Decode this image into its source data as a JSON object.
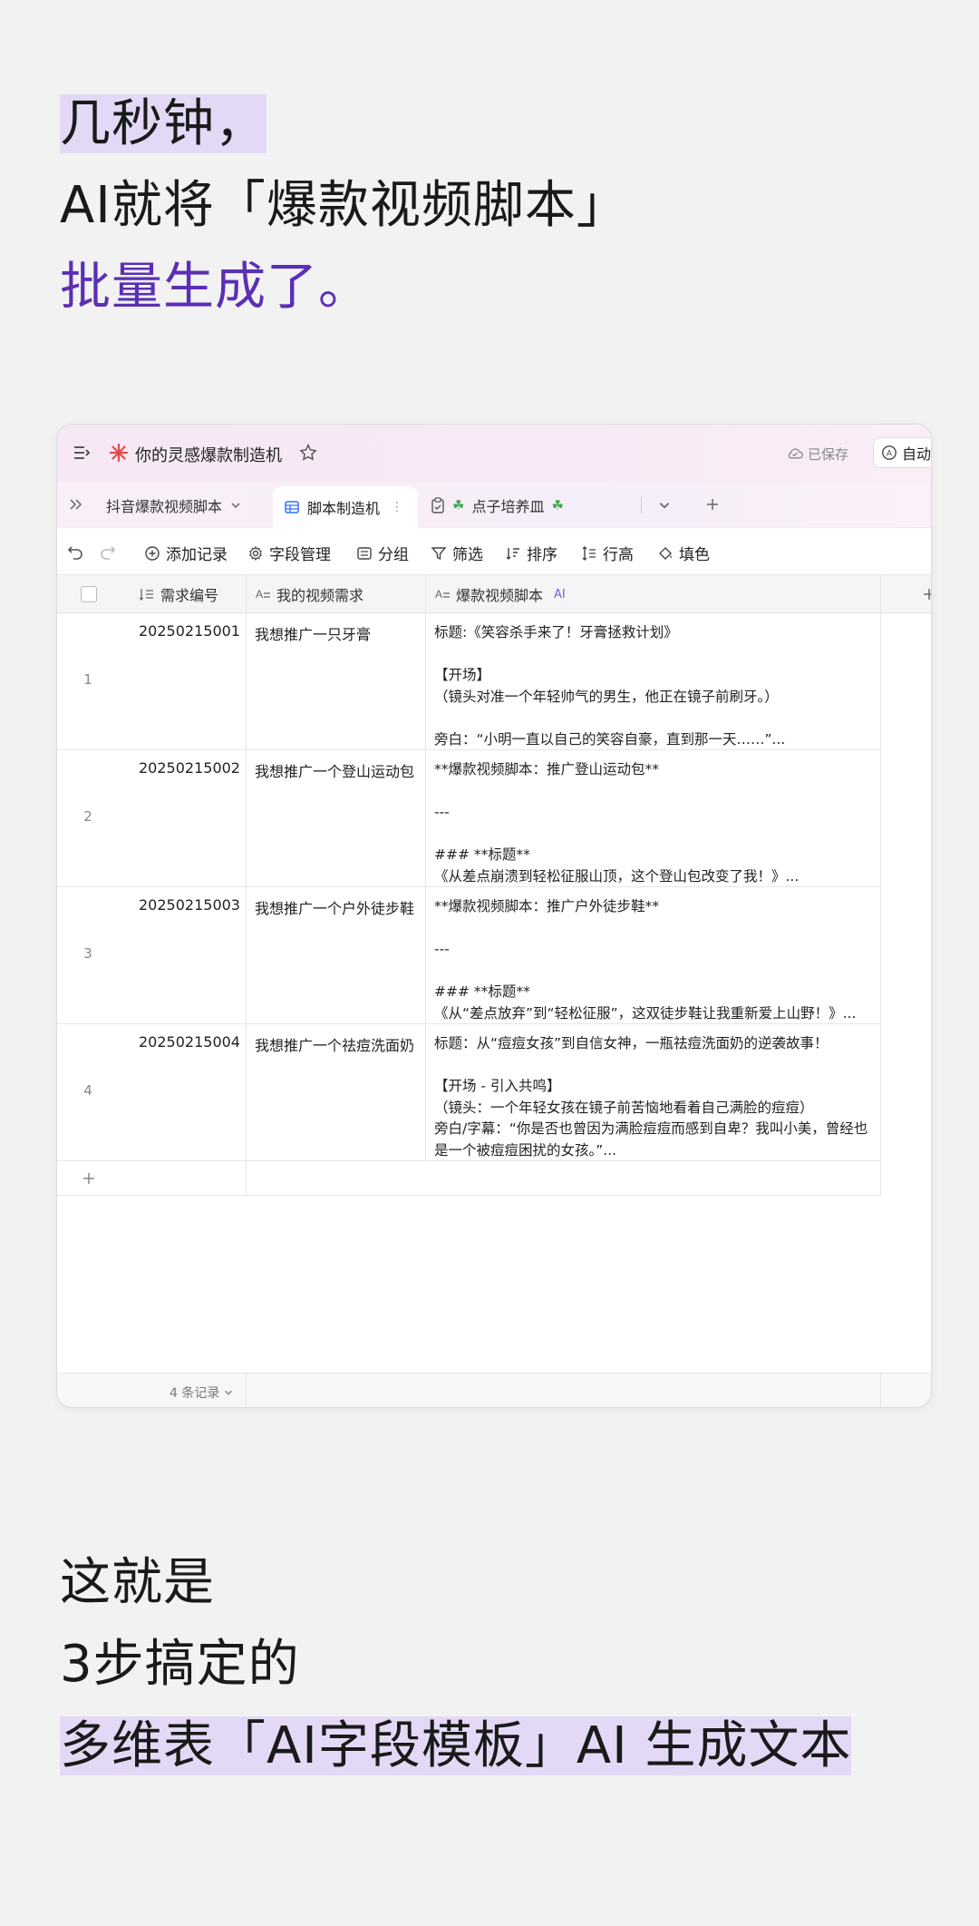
{
  "headline": {
    "line1": "几秒钟，",
    "line2": "AI就将「爆款视频脚本」",
    "line3": "批量生成了。"
  },
  "app": {
    "title": "你的灵感爆款制造机",
    "saved": "已保存",
    "auto": "自动",
    "tabs": [
      {
        "label": "抖音爆款视频脚本"
      },
      {
        "label": "脚本制造机"
      },
      {
        "label": "点子培养皿"
      }
    ],
    "toolbar": {
      "add_record": "添加记录",
      "field_manage": "字段管理",
      "group": "分组",
      "filter": "筛选",
      "sort": "排序",
      "row_height": "行高",
      "fill": "填色"
    },
    "columns": {
      "id": "需求编号",
      "need": "我的视频需求",
      "script": "爆款视频脚本",
      "script_badge": "AI"
    },
    "rows": [
      {
        "num": "1",
        "id": "20250215001",
        "need": "我想推广一只牙膏",
        "script": [
          "标题:《笑容杀手来了！牙膏拯救计划》",
          "",
          "【开场】",
          "（镜头对准一个年轻帅气的男生，他正在镜子前刷牙。）",
          "",
          "旁白：“小明一直以自己的笑容自豪，直到那一天……”..."
        ]
      },
      {
        "num": "2",
        "id": "20250215002",
        "need": "我想推广一个登山运动包",
        "script": [
          "**爆款视频脚本：推广登山运动包**",
          "",
          "---",
          "",
          "### **标题**",
          "《从差点崩溃到轻松征服山顶，这个登山包改变了我！》..."
        ]
      },
      {
        "num": "3",
        "id": "20250215003",
        "need": "我想推广一个户外徒步鞋",
        "script": [
          "**爆款视频脚本：推广户外徒步鞋**",
          "",
          "---",
          "",
          "### **标题**",
          "《从“差点放弃”到“轻松征服”，这双徒步鞋让我重新爱上山野！》..."
        ]
      },
      {
        "num": "4",
        "id": "20250215004",
        "need": "我想推广一个祛痘洗面奶",
        "script": [
          "标题：从“痘痘女孩”到自信女神，一瓶祛痘洗面奶的逆袭故事！",
          "",
          "【开场 - 引入共鸣】",
          "（镜头：一个年轻女孩在镜子前苦恼地看着自己满脸的痘痘）",
          "旁白/字幕：“你是否也曾因为满脸痘痘而感到自卑？我叫小美，曾经也",
          "是一个被痘痘困扰的女孩。”..."
        ]
      }
    ],
    "record_count": "4 条记录"
  },
  "footer": {
    "line1": "这就是",
    "line2": "3步搞定的",
    "line3": "多维表「AI字段模板」AI 生成文本"
  },
  "colors": {
    "accent_purple": "#5b2fb4",
    "highlight": "#e3d9f6"
  }
}
